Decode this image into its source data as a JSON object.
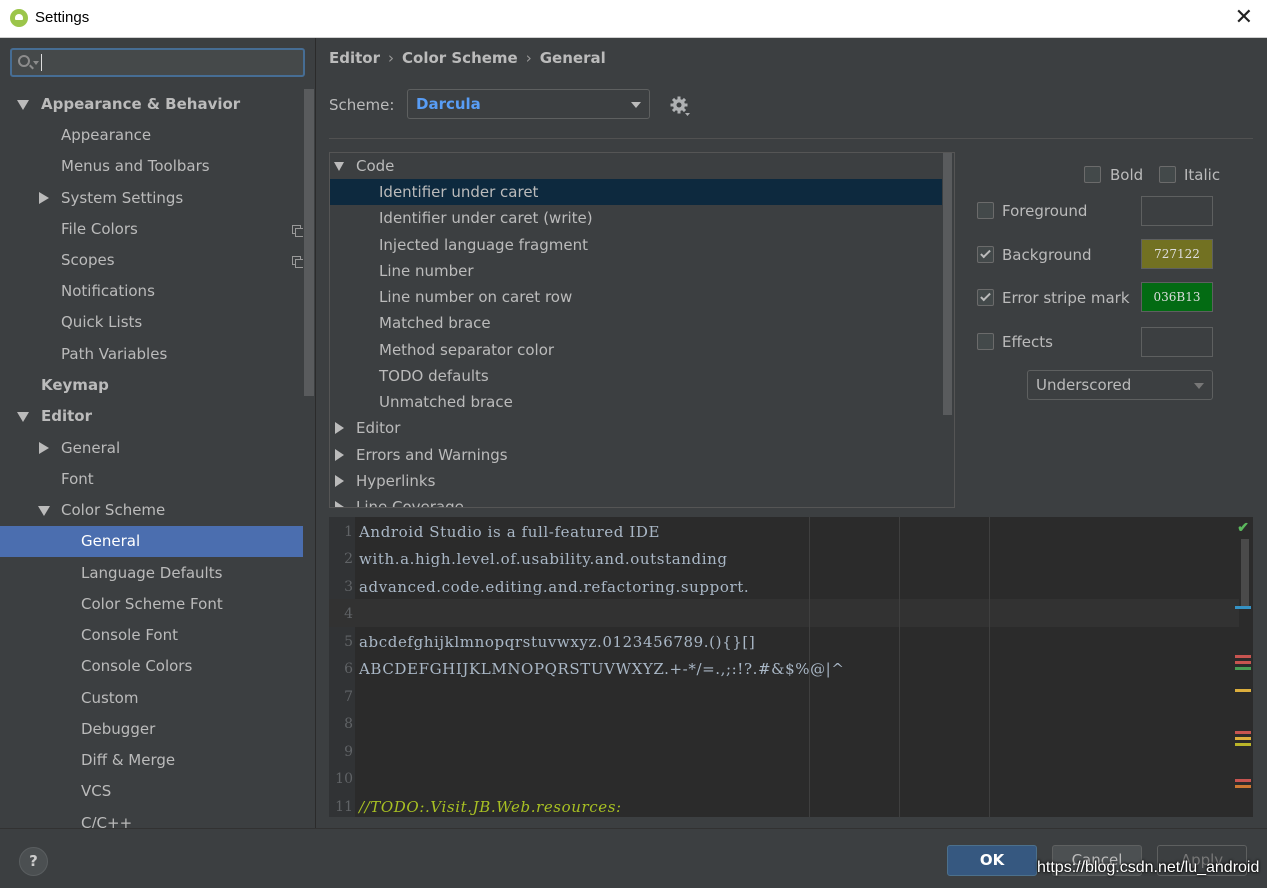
{
  "window": {
    "title": "Settings",
    "close_glyph": "✕"
  },
  "search": {
    "value": "",
    "placeholder": ""
  },
  "nav": {
    "items": [
      {
        "label": "Appearance & Behavior"
      },
      {
        "label": "Appearance"
      },
      {
        "label": "Menus and Toolbars"
      },
      {
        "label": "System Settings"
      },
      {
        "label": "File Colors"
      },
      {
        "label": "Scopes"
      },
      {
        "label": "Notifications"
      },
      {
        "label": "Quick Lists"
      },
      {
        "label": "Path Variables"
      },
      {
        "label": "Keymap"
      },
      {
        "label": "Editor"
      },
      {
        "label": "General"
      },
      {
        "label": "Font"
      },
      {
        "label": "Color Scheme"
      },
      {
        "label": "General"
      },
      {
        "label": "Language Defaults"
      },
      {
        "label": "Color Scheme Font"
      },
      {
        "label": "Console Font"
      },
      {
        "label": "Console Colors"
      },
      {
        "label": "Custom"
      },
      {
        "label": "Debugger"
      },
      {
        "label": "Diff & Merge"
      },
      {
        "label": "VCS"
      },
      {
        "label": "C/C++"
      }
    ]
  },
  "breadcrumb": {
    "items": [
      "Editor",
      "Color Scheme",
      "General"
    ],
    "separator": "›"
  },
  "scheme": {
    "label": "Scheme:",
    "value": "Darcula"
  },
  "tree": {
    "rows": [
      {
        "label": "Code"
      },
      {
        "label": "Identifier under caret"
      },
      {
        "label": "Identifier under caret (write)"
      },
      {
        "label": "Injected language fragment"
      },
      {
        "label": "Line number"
      },
      {
        "label": "Line number on caret row"
      },
      {
        "label": "Matched brace"
      },
      {
        "label": "Method separator color"
      },
      {
        "label": "TODO defaults"
      },
      {
        "label": "Unmatched brace"
      },
      {
        "label": "Editor"
      },
      {
        "label": "Errors and Warnings"
      },
      {
        "label": "Hyperlinks"
      },
      {
        "label": "Line Coverage"
      }
    ]
  },
  "attributes": {
    "bold": {
      "label": "Bold",
      "checked": false
    },
    "italic": {
      "label": "Italic",
      "checked": false
    },
    "foreground": {
      "label": "Foreground",
      "checked": false,
      "color": ""
    },
    "background": {
      "label": "Background",
      "checked": true,
      "color": "727122",
      "hex": "#727122"
    },
    "error_stripe": {
      "label": "Error stripe mark",
      "checked": true,
      "color": "036B13",
      "hex": "#036B13"
    },
    "effects": {
      "label": "Effects",
      "checked": false,
      "color": "",
      "style": "Underscored"
    }
  },
  "preview": {
    "line_numbers": [
      "1",
      "2",
      "3",
      "4",
      "5",
      "6",
      "7",
      "8",
      "9",
      "10",
      "11"
    ],
    "lines": [
      "Android Studio is a full-featured IDE",
      "with.a.high.level.of.usability.and.outstanding",
      "advanced.code.editing.and.refactoring.support.",
      "",
      "abcdefghijklmnopqrstuvwxyz.0123456789.(){}[]",
      "ABCDEFGHIJKLMNOPQRSTUVWXYZ.+-*/=.,;:!?.#&$%@|^",
      "",
      "",
      "",
      "",
      "//TODO:.Visit.JB.Web.resources:"
    ],
    "ok_mark": "✔",
    "stripe_colors": [
      "#c75450",
      "#c75450",
      "#499c54",
      "#dcae3d",
      "#c75450",
      "#dcae3d",
      "#bbb529",
      "#c75450",
      "#cc7832"
    ]
  },
  "footer": {
    "help": "?",
    "ok": "OK",
    "cancel": "Cancel",
    "apply": "Apply",
    "watermark": "https://blog.csdn.net/lu_android"
  },
  "colors": {
    "selection_nav": "#4b6eaf",
    "selection_tree": "#0d293e",
    "scheme_value": "#589df6",
    "todo": "#a8c023"
  }
}
